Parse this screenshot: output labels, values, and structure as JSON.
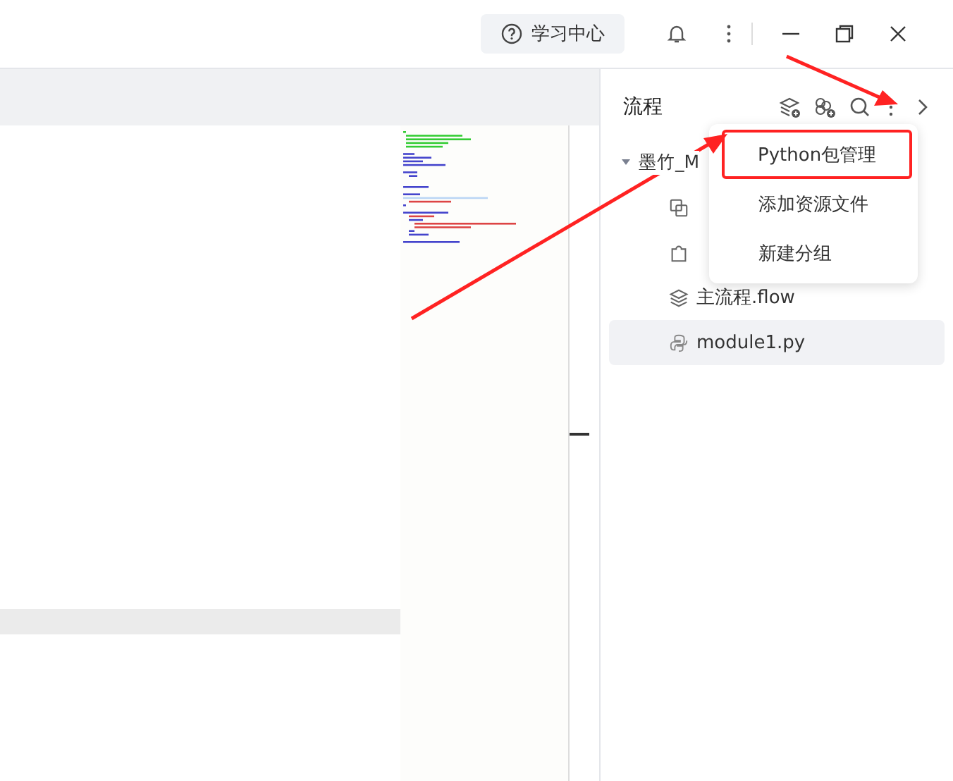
{
  "title_bar": {
    "learning_center": "学习中心"
  },
  "panel": {
    "title": "流程"
  },
  "tree": [
    {
      "label": "墨竹_M",
      "expanded": true,
      "selected": false,
      "children": [
        {
          "kind": "component",
          "selected": false
        },
        {
          "kind": "resource",
          "selected": false
        },
        {
          "label": "主流程.flow",
          "kind": "flow",
          "selected": false
        },
        {
          "label": "module1.py",
          "kind": "python",
          "selected": true
        }
      ]
    }
  ],
  "menu": {
    "items": [
      {
        "label": "Python包管理",
        "selected": true
      },
      {
        "label": "添加资源文件",
        "selected": false
      },
      {
        "label": "新建分组",
        "selected": false
      }
    ]
  }
}
